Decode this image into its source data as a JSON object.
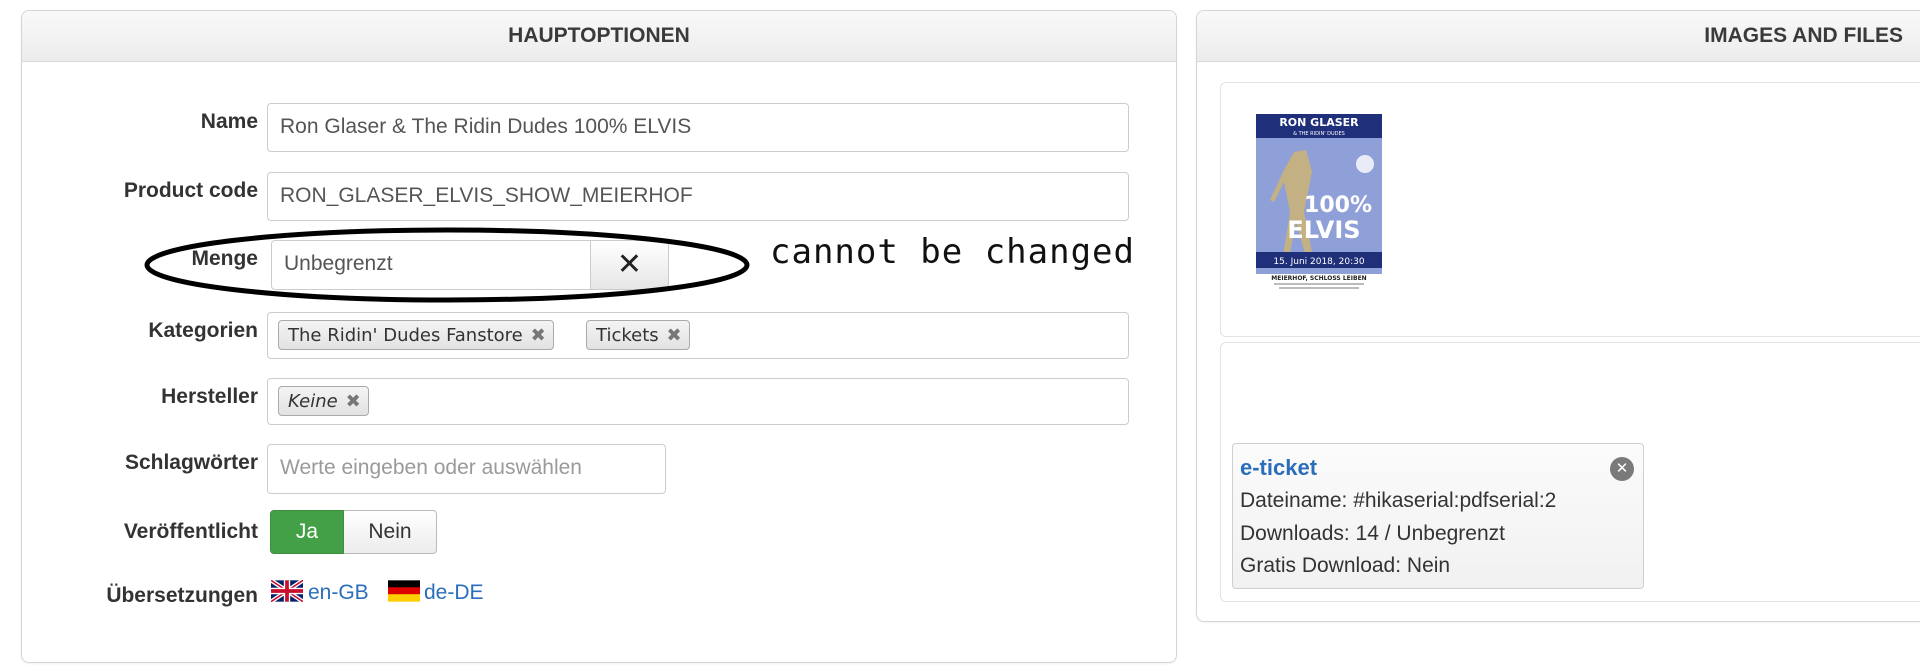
{
  "left_panel": {
    "title": "HAUPTOPTIONEN",
    "fields": {
      "name": {
        "label": "Name",
        "value": "Ron Glaser & The Ridin Dudes 100% ELVIS"
      },
      "product_code": {
        "label": "Product code",
        "value": "RON_GLASER_ELVIS_SHOW_MEIERHOF"
      },
      "menge": {
        "label": "Menge",
        "value": "Unbegrenzt",
        "clear_icon": "close-icon"
      },
      "kategorien": {
        "label": "Kategorien",
        "tags": [
          "The Ridin' Dudes Fanstore",
          "Tickets"
        ]
      },
      "hersteller": {
        "label": "Hersteller",
        "tags": [
          "Keine"
        ]
      },
      "schlagwoerter": {
        "label": "Schlagwörter",
        "placeholder": "Werte eingeben oder auswählen"
      },
      "veroeffentlicht": {
        "label": "Veröffentlicht",
        "options": [
          "Ja",
          "Nein"
        ],
        "selected": "Ja",
        "active_color": "#43a047"
      },
      "uebersetzungen": {
        "label": "Übersetzungen",
        "languages": [
          "en-GB",
          "de-DE"
        ]
      }
    }
  },
  "annotation": {
    "note": "cannot be changed"
  },
  "right_panel": {
    "title": "IMAGES AND FILES",
    "image": {
      "poster_lines": [
        "RON GLASER",
        "& THE RIDIN' DUDES",
        "100%",
        "ELVIS",
        "15. Juni 2018, 20:30",
        "MEIERHOF, SCHLOSS LEIBEN"
      ]
    },
    "file": {
      "title": "e-ticket",
      "filename": "Dateiname: #hikaserial:pdfserial:2",
      "downloads": "Downloads: 14 / Unbegrenzt",
      "free_download": "Gratis Download: Nein"
    }
  },
  "colors": {
    "link": "#2a6ebb",
    "success": "#43a047"
  }
}
